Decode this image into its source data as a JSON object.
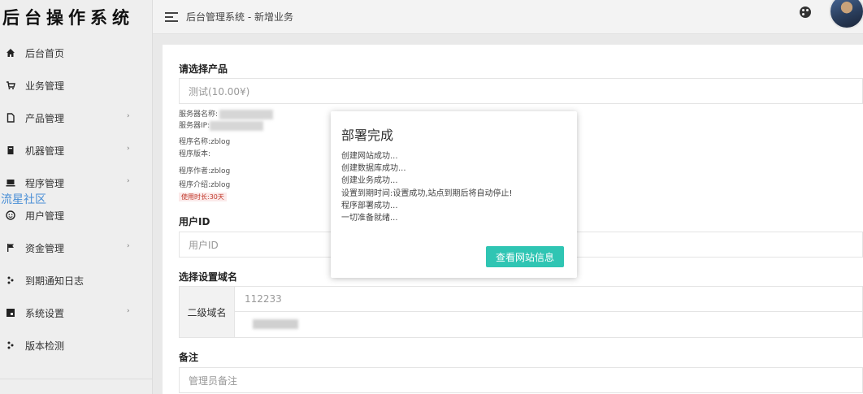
{
  "sidebar": {
    "logo": "后台操作系统",
    "items": [
      {
        "label": "后台首页",
        "icon": "home-icon",
        "arrow": ""
      },
      {
        "label": "业务管理",
        "icon": "cart-icon",
        "arrow": ""
      },
      {
        "label": "产品管理",
        "icon": "file-icon",
        "arrow": "›"
      },
      {
        "label": "机器管理",
        "icon": "server-icon",
        "arrow": "›"
      },
      {
        "label": "程序管理",
        "icon": "monitor-icon",
        "arrow": "›"
      },
      {
        "label": "用户管理",
        "icon": "user-icon",
        "arrow": ""
      },
      {
        "label": "资金管理",
        "icon": "flag-icon",
        "arrow": "›"
      },
      {
        "label": "到期通知日志",
        "icon": "sparkle-icon",
        "arrow": ""
      },
      {
        "label": "系统设置",
        "icon": "js-icon",
        "arrow": "›"
      },
      {
        "label": "版本检测",
        "icon": "sparkle-icon",
        "arrow": ""
      }
    ],
    "watermark": "流星社区"
  },
  "header": {
    "breadcrumb": "后台管理系统 - 新增业务"
  },
  "form": {
    "product_label": "请选择产品",
    "product_value": "测试(10.00¥)",
    "info": {
      "server_name": "服务器名称:",
      "server_ip": "服务器IP:",
      "program_name": "程序名称:zblog",
      "program_version": "程序版本:",
      "program_author": "程序作者:zblog",
      "program_intro": "程序介绍:zblog",
      "duration": "使用时长:30天"
    },
    "user_id_label": "用户ID",
    "user_id_placeholder": "用户ID",
    "domain_label": "选择设置域名",
    "domain_prefix": "二级域名",
    "domain_value": "112233",
    "note_label": "备注",
    "note_placeholder": "管理员备注"
  },
  "modal": {
    "title": "部署完成",
    "lines": [
      "创建网站成功...",
      "创建数据库成功...",
      "创建业务成功...",
      "设置到期时间:设置成功,站点到期后将自动停止!",
      "程序部署成功...",
      "一切准备就绪..."
    ],
    "button": "查看网站信息"
  },
  "colors": {
    "accent": "#2fc5b3",
    "watermark": "#4a8fd6",
    "duration_tag": "#c0392b"
  }
}
